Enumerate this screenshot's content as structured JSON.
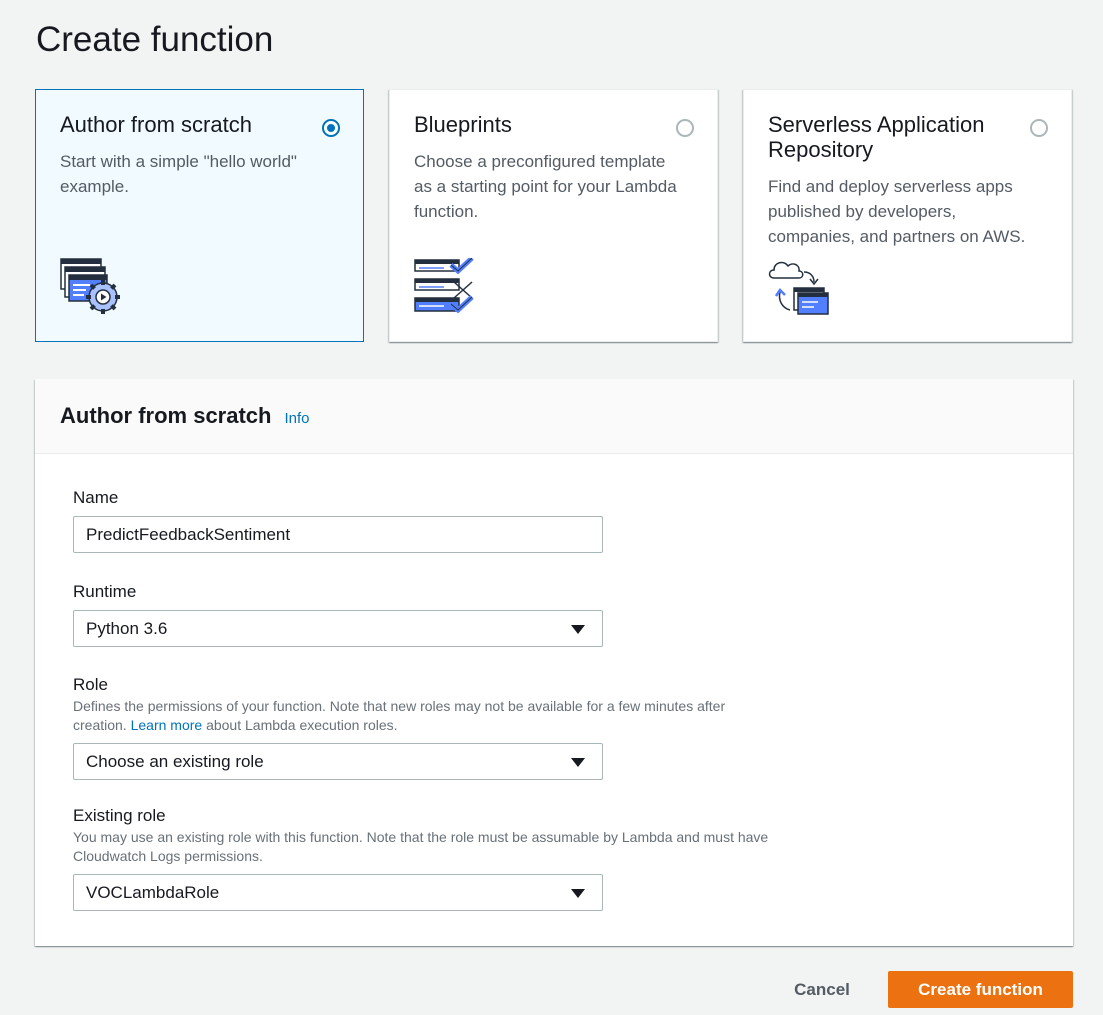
{
  "page": {
    "title": "Create function"
  },
  "options": [
    {
      "title": "Author from scratch",
      "description": "Start with a simple \"hello world\" example.",
      "selected": true,
      "icon": "code-gear-icon"
    },
    {
      "title": "Blueprints",
      "description": "Choose a preconfigured template as a starting point for your Lambda function.",
      "selected": false,
      "icon": "checklist-icon"
    },
    {
      "title": "Serverless Application Repository",
      "description": "Find and deploy serverless apps published by developers, companies, and partners on AWS.",
      "selected": false,
      "icon": "cloud-deploy-icon"
    }
  ],
  "form": {
    "title": "Author from scratch",
    "info_link": "Info",
    "name": {
      "label": "Name",
      "value": "PredictFeedbackSentiment"
    },
    "runtime": {
      "label": "Runtime",
      "value": "Python 3.6"
    },
    "role": {
      "label": "Role",
      "desc_before": "Defines the permissions of your function. Note that new roles may not be available for a few minutes after creation. ",
      "desc_link": "Learn more",
      "desc_after": " about Lambda execution roles.",
      "value": "Choose an existing role"
    },
    "existing_role": {
      "label": "Existing role",
      "description": "You may use an existing role with this function. Note that the role must be assumable by Lambda and must have Cloudwatch Logs permissions.",
      "value": "VOCLambdaRole"
    }
  },
  "footer": {
    "cancel_label": "Cancel",
    "create_label": "Create function"
  },
  "colors": {
    "accent": "#0073bb",
    "primary_button": "#ec7211",
    "selected_card_bg": "#f1faff"
  }
}
